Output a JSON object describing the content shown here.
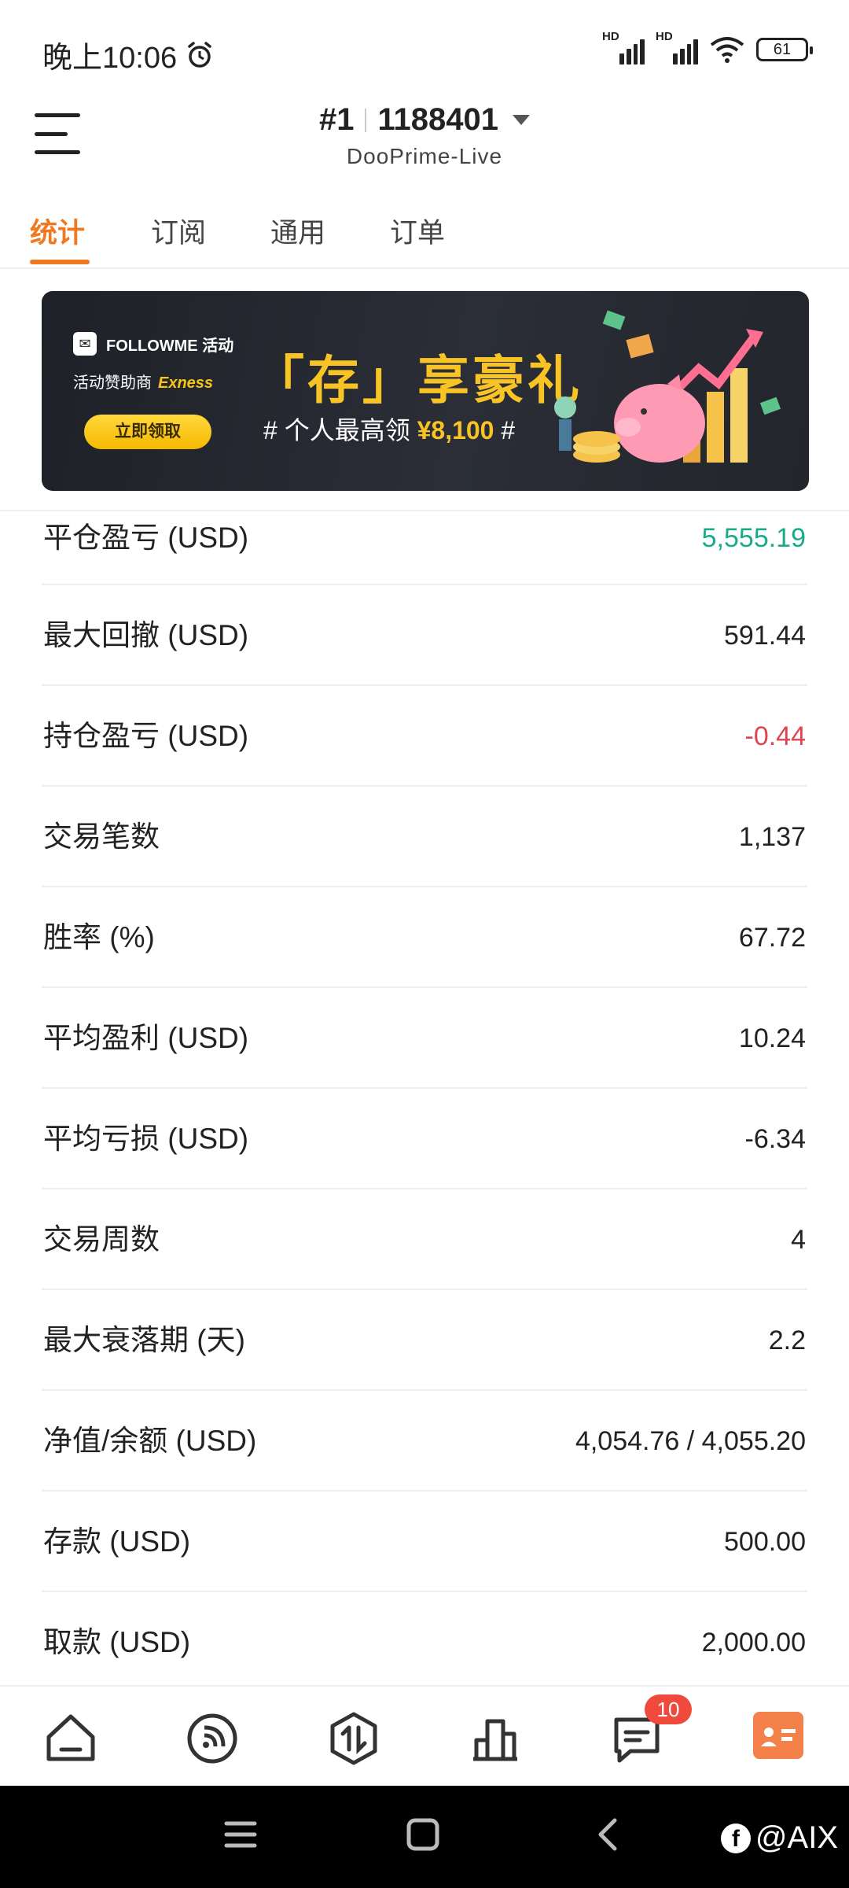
{
  "status_bar": {
    "time": "晚上10:06",
    "battery": "61",
    "signal_badge_1": "HD",
    "signal_badge_2": "HD"
  },
  "header": {
    "rank": "#1",
    "account_id": "1188401",
    "server": "DooPrime-Live"
  },
  "tabs": [
    {
      "label": "统计",
      "active": true
    },
    {
      "label": "订阅",
      "active": false
    },
    {
      "label": "通用",
      "active": false
    },
    {
      "label": "订单",
      "active": false
    }
  ],
  "banner": {
    "brand": "FOLLOWME 活动",
    "sponsor_prefix": "活动赞助商",
    "sponsor": "Exness",
    "button": "立即领取",
    "title": "「存」享豪礼",
    "subtitle_prefix": "# 个人最高领",
    "subtitle_amount": "¥8,100",
    "subtitle_suffix": "#"
  },
  "stats": [
    {
      "label": "平仓盈亏 (USD)",
      "value": "5,555.19",
      "color": "#1aab8a"
    },
    {
      "label": "最大回撤 (USD)",
      "value": "591.44"
    },
    {
      "label": "持仓盈亏 (USD)",
      "value": "-0.44",
      "color": "#e0454f"
    },
    {
      "label": "交易笔数",
      "value": "1,137"
    },
    {
      "label": "胜率 (%)",
      "value": "67.72"
    },
    {
      "label": "平均盈利 (USD)",
      "value": "10.24"
    },
    {
      "label": "平均亏损 (USD)",
      "value": "-6.34"
    },
    {
      "label": "交易周数",
      "value": "4"
    },
    {
      "label": "最大衰落期 (天)",
      "value": "2.2"
    },
    {
      "label": "净值/余额 (USD)",
      "value": "4,054.76 / 4,055.20"
    },
    {
      "label": "存款 (USD)",
      "value": "500.00"
    },
    {
      "label": "取款 (USD)",
      "value": "2,000.00"
    }
  ],
  "bottom_nav": {
    "items": [
      "home-icon",
      "subscribe-icon",
      "trade-icon",
      "ranking-icon",
      "message-icon",
      "profile-icon"
    ],
    "message_badge": "10",
    "accent": "#f4804a"
  },
  "watermark": {
    "fb": "f",
    "handle": "@AIX"
  },
  "colors": {
    "accent": "#f07820",
    "profit": "#1aab8a",
    "loss": "#e0454f"
  }
}
